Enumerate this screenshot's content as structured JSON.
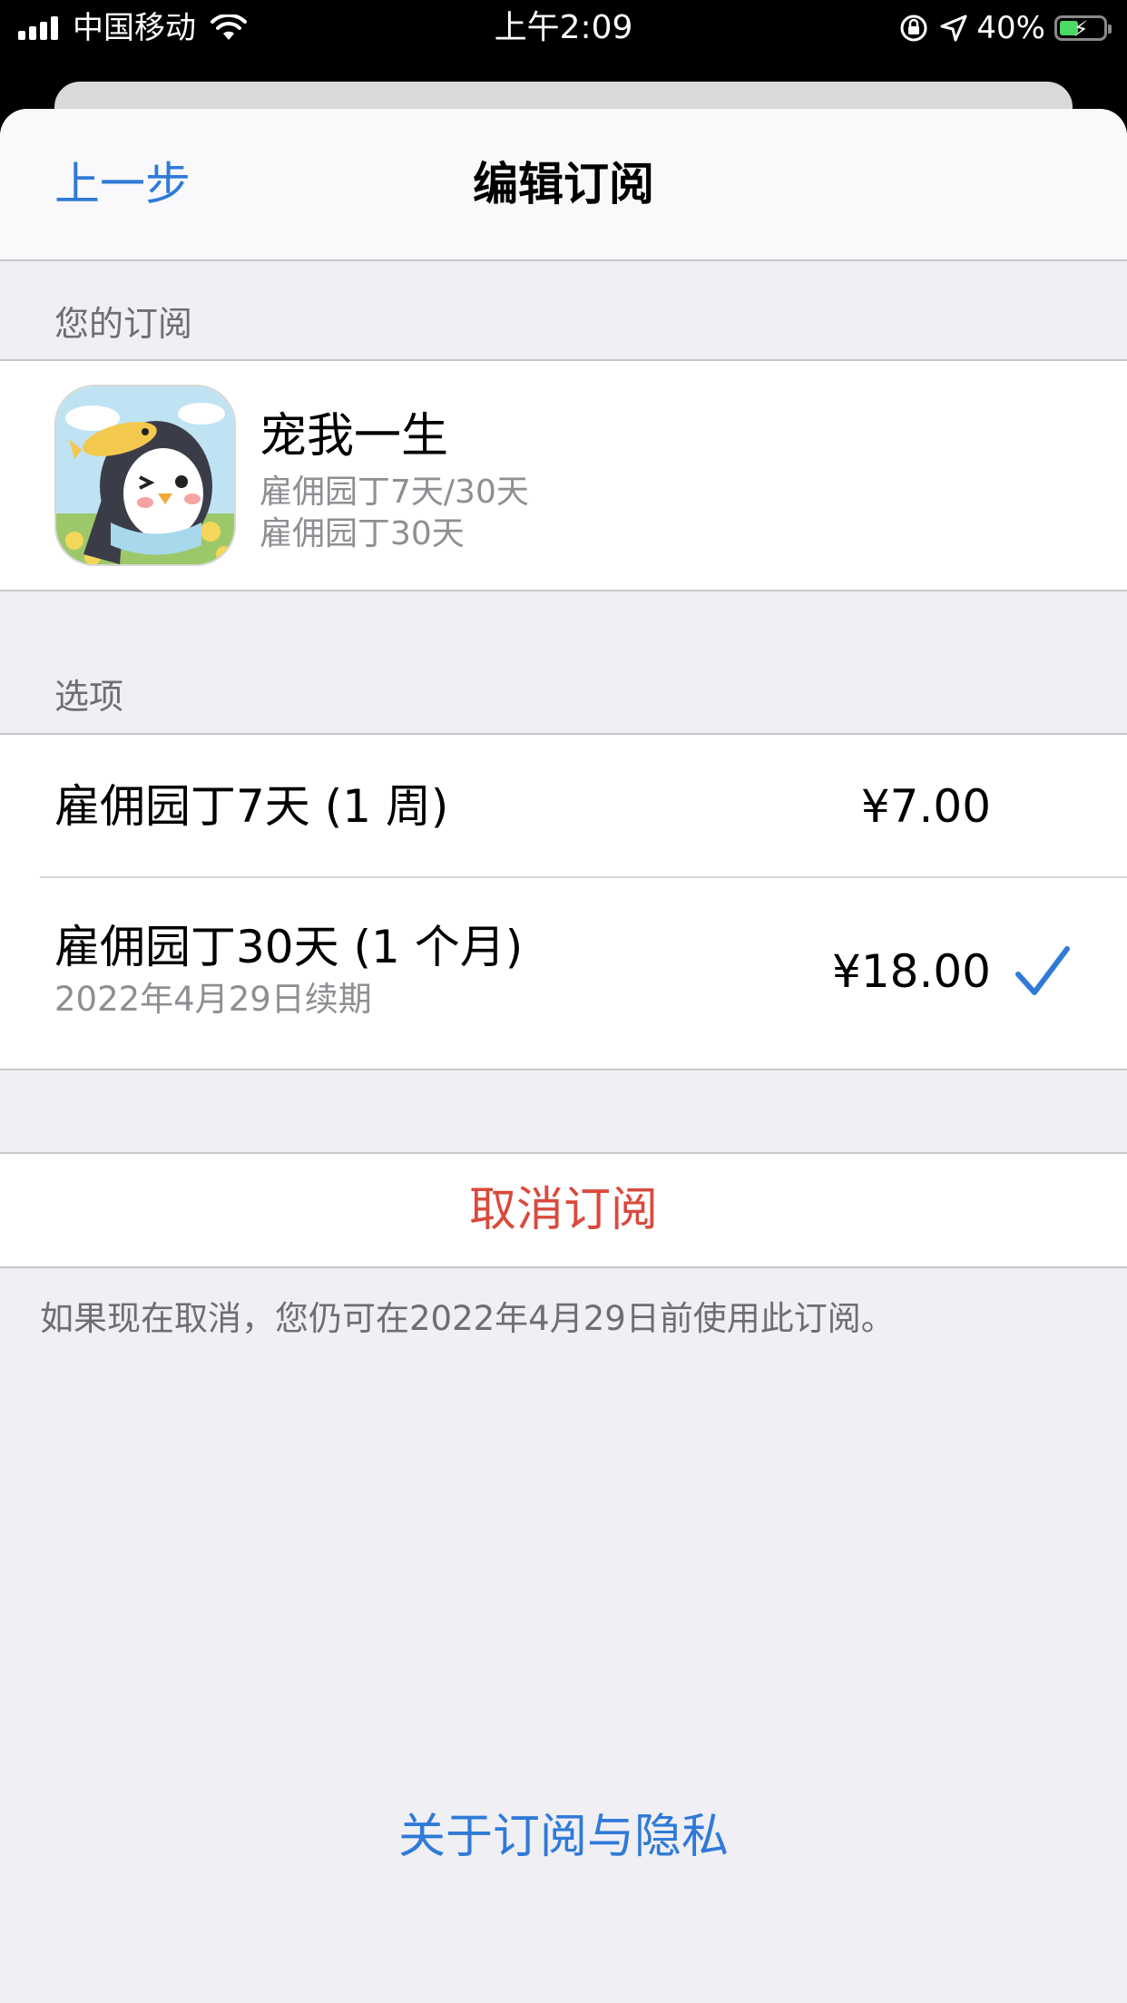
{
  "status_bar": {
    "carrier": "中国移动",
    "time": "上午2:09",
    "battery_percent": "40%"
  },
  "nav": {
    "back_label": "上一步",
    "title": "编辑订阅"
  },
  "subscription_section": {
    "header": "您的订阅",
    "app_name": "宠我一生",
    "line1": "雇佣园丁7天/30天",
    "line2": "雇佣园丁30天"
  },
  "options_section": {
    "header": "选项",
    "options": [
      {
        "title": "雇佣园丁7天 (1 周)",
        "price": "¥7.00",
        "subtitle": "",
        "selected": false
      },
      {
        "title": "雇佣园丁30天 (1 个月)",
        "price": "¥18.00",
        "subtitle": "2022年4月29日续期",
        "selected": true
      }
    ]
  },
  "cancel": {
    "label": "取消订阅",
    "note": "如果现在取消，您仍可在2022年4月29日前使用此订阅。"
  },
  "privacy_link": "关于订阅与隐私",
  "colors": {
    "accent_blue": "#2f7ad8",
    "destructive_red": "#d94a3d",
    "background_gray": "#efeff4"
  }
}
